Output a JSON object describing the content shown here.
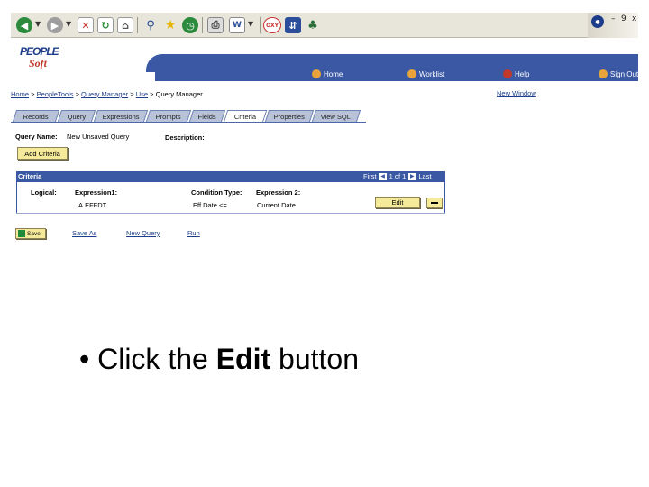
{
  "toolbar": {
    "icons": [
      "back-icon",
      "forward-icon",
      "stop-icon",
      "refresh-icon",
      "home-icon",
      "search-icon",
      "favorites-icon",
      "history-icon",
      "print-icon",
      "edit-icon",
      "discuss-icon",
      "messenger-icon",
      "research-icon"
    ],
    "window_controls": {
      "minimize": "–",
      "restore": "9",
      "close": "x"
    }
  },
  "logo": {
    "line1": "PEOPLE",
    "line2": "Soft"
  },
  "nav": {
    "home": "Home",
    "worklist": "Worklist",
    "help": "Help",
    "signout": "Sign Out"
  },
  "breadcrumb": {
    "items": [
      "Home",
      "PeopleTools",
      "Query Manager",
      "Use",
      "Query Manager"
    ],
    "separator": ">"
  },
  "new_window": "New Window",
  "tabs": [
    "Records",
    "Query",
    "Expressions",
    "Prompts",
    "Fields",
    "Criteria",
    "Properties",
    "View SQL"
  ],
  "active_tab": "Criteria",
  "query": {
    "name_label": "Query Name:",
    "name_value": "New Unsaved Query",
    "description_label": "Description:"
  },
  "add_criteria_label": "Add Criteria",
  "grid": {
    "title": "Criteria",
    "nav": {
      "first": "First",
      "position": "1 of 1",
      "last": "Last"
    },
    "columns": [
      "Logical:",
      "Expression1:",
      "Condition Type:",
      "Expression 2:"
    ],
    "row": {
      "logical": "",
      "expression1": "A.EFFDT",
      "condition": "Eff Date <=",
      "expression2": "Current Date"
    },
    "edit_label": "Edit"
  },
  "actions": {
    "save": "Save",
    "save_as": "Save As",
    "new_query": "New Query",
    "run": "Run"
  },
  "caption": {
    "bullet": "•",
    "pre": "Click the",
    "bold": "Edit",
    "post": "button"
  },
  "colors": {
    "brand_blue": "#3a58a4",
    "button_yellow": "#f5ea9a",
    "link": "#1c3e8a"
  }
}
